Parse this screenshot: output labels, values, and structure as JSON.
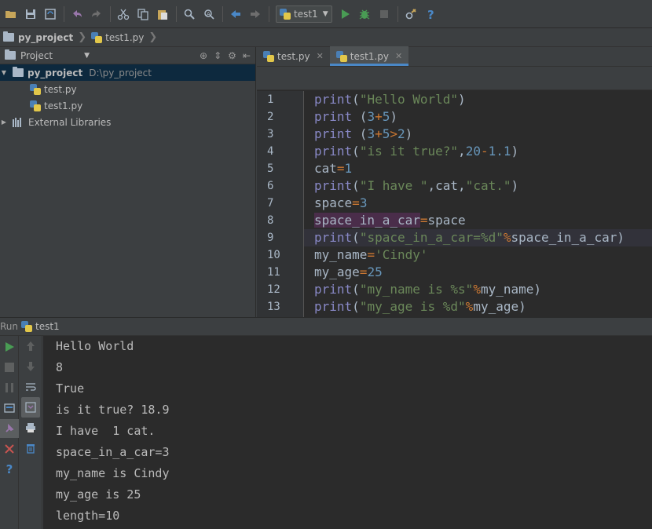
{
  "toolbar": {
    "run_config": "test1"
  },
  "navbar": {
    "project": "py_project",
    "file": "test1.py"
  },
  "project_panel": {
    "title": "Project",
    "root": {
      "name": "py_project",
      "path": "D:\\py_project"
    },
    "files": [
      "test.py",
      "test1.py"
    ],
    "external": "External Libraries"
  },
  "editor": {
    "tabs": [
      {
        "label": "test.py",
        "active": false
      },
      {
        "label": "test1.py",
        "active": true
      }
    ],
    "line_numbers": [
      "1",
      "2",
      "3",
      "4",
      "5",
      "6",
      "7",
      "8",
      "9",
      "10",
      "11",
      "12",
      "13"
    ],
    "code": [
      "print(\"Hello World\")",
      "print (3+5)",
      "print (3+5>2)",
      "print(\"is it true?\",20-1.1)",
      "cat=1",
      "print(\"I have \",cat,\"cat.\")",
      "space=3",
      "space_in_a_car=space",
      "print(\"space_in_a_car=%d\"%space_in_a_car)",
      "my_name='Cindy'",
      "my_age=25",
      "print(\"my_name is %s\"%my_name)",
      "print(\"my_age is %d\"%my_age)"
    ]
  },
  "run": {
    "label": "Run",
    "config": "test1",
    "output": [
      "Hello World",
      "8",
      "True",
      "is it true? 18.9",
      "I have  1 cat.",
      "space_in_a_car=3",
      "my_name is Cindy",
      "my_age is 25",
      "length=10"
    ]
  },
  "colors": {
    "keyword": "#8888c6",
    "string": "#6a8759",
    "number": "#6897bb",
    "operator": "#cc7832",
    "run_green": "#499c54",
    "stop_red": "#c75450",
    "accent_blue": "#4a88c7"
  }
}
